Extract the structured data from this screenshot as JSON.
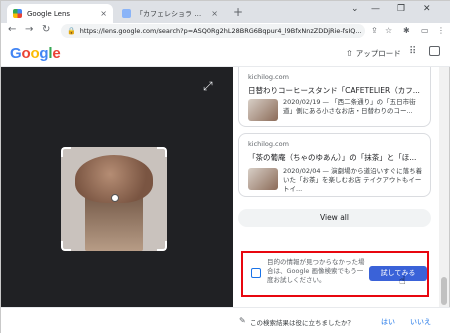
{
  "browser": {
    "tabs": [
      {
        "title": "Google Lens",
        "close": "×"
      },
      {
        "title": "「カフェレショラ 吉祥寺バルコ店 (カフェレショ",
        "close": "×"
      }
    ],
    "new_tab": "+",
    "window_controls": {
      "chevron": "⌄",
      "minimize": "—",
      "maximize": "❐",
      "close": "✕"
    },
    "nav": {
      "back": "←",
      "forward": "→",
      "reload": "↻"
    },
    "url": "https://lens.google.com/search?p=ASQ0Rg2hL28BRG6Bqpur4_l9BfxNnzZDDjRie-fsIQ...",
    "toolbar_icons": {
      "share": "⇪",
      "star": "☆",
      "extension": "✱",
      "menu": "⋮"
    }
  },
  "lens_header": {
    "logo_letters": [
      {
        "ch": "G",
        "color": "#4285f4"
      },
      {
        "ch": "o",
        "color": "#ea4335"
      },
      {
        "ch": "o",
        "color": "#fbbc05"
      },
      {
        "ch": "g",
        "color": "#4285f4"
      },
      {
        "ch": "l",
        "color": "#34a853"
      },
      {
        "ch": "e",
        "color": "#ea4335"
      }
    ],
    "upload_label": "アップロード",
    "apps_icon": "⠿"
  },
  "image_pane": {
    "expand_icon": "⤢"
  },
  "results": {
    "cards": [
      {
        "source": "kichilog.com",
        "title": "日替わりコーヒースタンド「CAFETELIER（カフ...",
        "snippet": "2020/02/19 — 「西二条通り」の「五日市街道」側にある小さなお店・日替わりのコー..."
      },
      {
        "source": "kichilog.com",
        "title": "「茶の葡庵（ちゃのゆあん）」の「抹茶」と「ほ...",
        "snippet": "2020/02/04 — 演劇場から道沿いすぐに落ち着いた「お茶」を楽しむお店 テイクアウトもイートイ..."
      }
    ],
    "view_all": "View all",
    "not_found_text": "目的の情報が見つからなかった場合は、Google 画像検索でもう一度お試しください。",
    "try_button": "試してみる"
  },
  "footer": {
    "question": "この検索結果は役に立ちましたか？",
    "yes": "はい",
    "no": "いいえ",
    "icon": "✎"
  },
  "colors": {
    "highlight": "#e8070f",
    "button": "#3a62d8",
    "link": "#1a73e8"
  }
}
